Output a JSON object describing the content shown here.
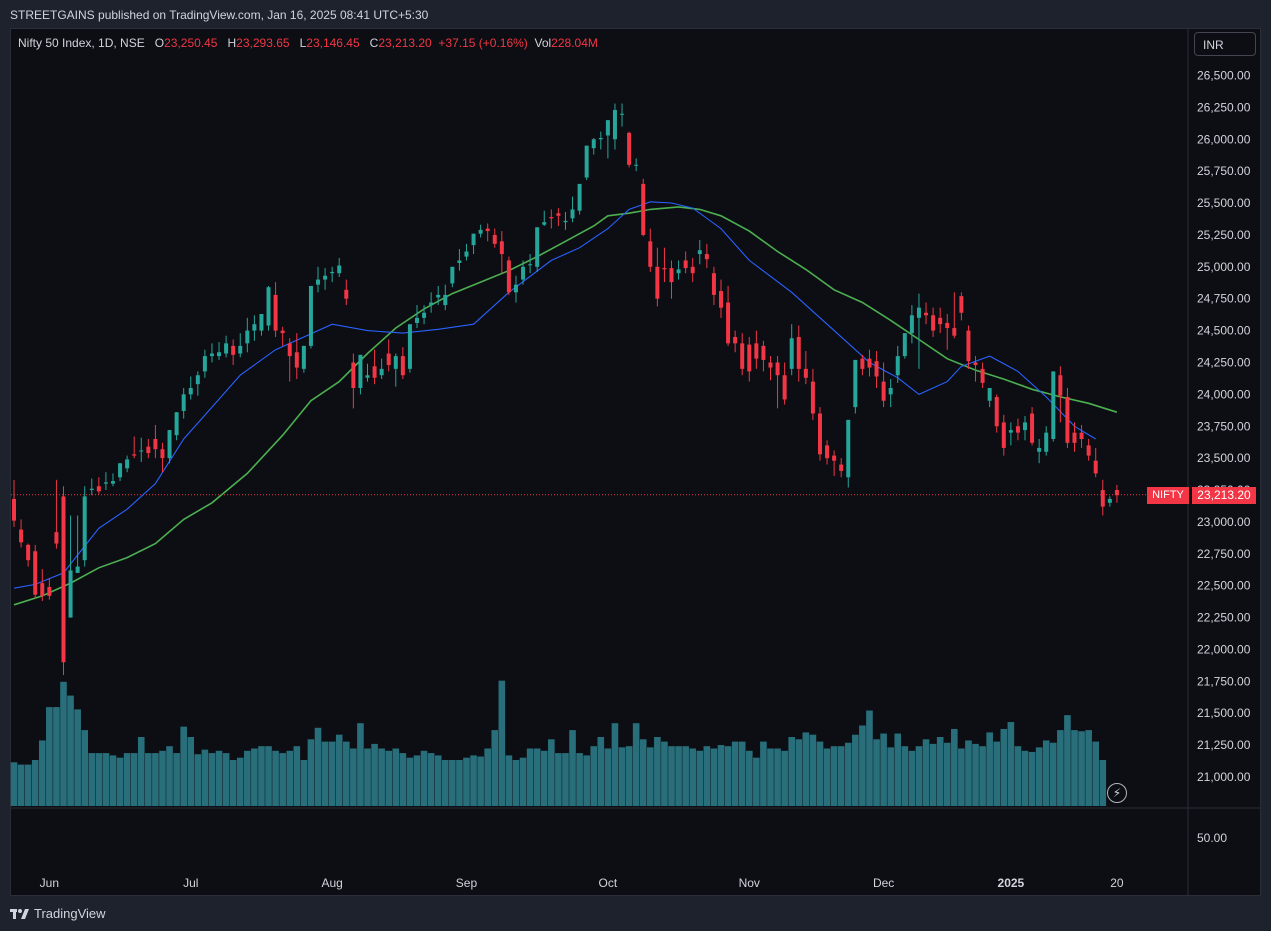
{
  "header": {
    "publish_line": "STREETGAINS published on TradingView.com, Jan 16, 2025 08:41 UTC+5:30"
  },
  "legend": {
    "symbol": "Nifty 50 Index, 1D, NSE",
    "open_label": "O",
    "open": "23,250.45",
    "high_label": "H",
    "high": "23,293.65",
    "low_label": "L",
    "low": "23,146.45",
    "close_label": "C",
    "close": "23,213.20",
    "change": "+37.15 (+0.16%)",
    "vol_label": "Vol",
    "vol": "228.04M"
  },
  "currency_button": "INR",
  "footer": {
    "brand": "TradingView",
    "logo_icon": "tradingview-logo-icon"
  },
  "bolt_icon": "lightning-icon",
  "colors": {
    "up": "#26a69a",
    "down": "#f23645",
    "ma_fast": "#2962ff",
    "ma_slow": "#4caf50",
    "volume": "#2a7581",
    "background": "#0c0e13"
  },
  "chart_data": {
    "type": "candlestick",
    "symbol_tag": "NIFTY",
    "last_price_label": "23,213.20",
    "last_price": 23213.2,
    "price_axis": {
      "ylim": [
        20850,
        26650
      ],
      "ticks": [
        "26,500.00",
        "26,250.00",
        "26,000.00",
        "25,750.00",
        "25,500.00",
        "25,250.00",
        "25,000.00",
        "24,750.00",
        "24,500.00",
        "24,250.00",
        "24,000.00",
        "23,750.00",
        "23,500.00",
        "23,250.00",
        "23,000.00",
        "22,750.00",
        "22,500.00",
        "22,250.00",
        "22,000.00",
        "21,750.00",
        "21,500.00",
        "21,250.00",
        "21,000.00"
      ],
      "tick_values": [
        26500,
        26250,
        26000,
        25750,
        25500,
        25250,
        25000,
        24750,
        24500,
        24250,
        24000,
        23750,
        23500,
        23250,
        23000,
        22750,
        22500,
        22250,
        22000,
        21750,
        21500,
        21250,
        21000
      ]
    },
    "lower_pane_tick": "50.00",
    "x_axis_labels": [
      "Jun",
      "Jul",
      "Aug",
      "Sep",
      "Oct",
      "Nov",
      "Dec",
      "2025",
      "20"
    ],
    "x_axis_label_index": [
      5,
      25,
      45,
      64,
      84,
      104,
      123,
      141,
      156
    ],
    "candles": [
      [
        23180,
        23330,
        23010,
        22960
      ],
      [
        22940,
        23020,
        22840,
        22800
      ],
      [
        22820,
        22830,
        22700,
        22650
      ],
      [
        22770,
        22820,
        22430,
        22400
      ],
      [
        22520,
        22630,
        22420,
        22380
      ],
      [
        22490,
        22560,
        22420,
        22390
      ],
      [
        22920,
        23330,
        22830,
        22790
      ],
      [
        23200,
        23280,
        21900,
        21800
      ],
      [
        22250,
        23050,
        22620,
        22570
      ],
      [
        22600,
        23050,
        22650,
        22600
      ],
      [
        22700,
        23280,
        23200,
        22650
      ],
      [
        23250,
        23340,
        23260,
        23210
      ],
      [
        23280,
        23350,
        23240,
        23220
      ],
      [
        23300,
        23390,
        23310,
        23250
      ],
      [
        23300,
        23380,
        23320,
        23280
      ],
      [
        23350,
        23440,
        23460,
        23320
      ],
      [
        23420,
        23520,
        23490,
        23390
      ],
      [
        23530,
        23670,
        23520,
        23500
      ],
      [
        23560,
        23660,
        23560,
        23470
      ],
      [
        23590,
        23650,
        23540,
        23500
      ],
      [
        23650,
        23760,
        23570,
        23500
      ],
      [
        23570,
        23620,
        23500,
        23390
      ],
      [
        23500,
        23550,
        23720,
        23460
      ],
      [
        23680,
        23820,
        23860,
        23640
      ],
      [
        23870,
        24050,
        24000,
        23810
      ],
      [
        24000,
        24140,
        24050,
        23960
      ],
      [
        24080,
        24180,
        24150,
        23990
      ],
      [
        24180,
        24350,
        24300,
        24130
      ],
      [
        24300,
        24400,
        24320,
        24250
      ],
      [
        24300,
        24410,
        24330,
        24270
      ],
      [
        24320,
        24460,
        24400,
        24290
      ],
      [
        24380,
        24430,
        24310,
        24230
      ],
      [
        24320,
        24480,
        24380,
        24290
      ],
      [
        24400,
        24600,
        24500,
        24330
      ],
      [
        24500,
        24620,
        24550,
        24420
      ],
      [
        24500,
        24620,
        24630,
        24460
      ],
      [
        24540,
        24850,
        24840,
        24500
      ],
      [
        24780,
        24880,
        24500,
        24450
      ],
      [
        24500,
        24530,
        24480,
        24380
      ],
      [
        24400,
        24440,
        24300,
        24100
      ],
      [
        24330,
        24480,
        24210,
        24120
      ],
      [
        24200,
        24350,
        24380,
        24170
      ],
      [
        24380,
        24840,
        24850,
        24360
      ],
      [
        24860,
        25000,
        24900,
        24800
      ],
      [
        24900,
        24990,
        24930,
        24820
      ],
      [
        24950,
        25000,
        24960,
        24880
      ],
      [
        24950,
        25070,
        25010,
        24920
      ],
      [
        24820,
        24900,
        24750,
        24700
      ],
      [
        24250,
        24320,
        24050,
        23890
      ],
      [
        24050,
        24310,
        24310,
        24000
      ],
      [
        24130,
        24240,
        24150,
        24100
      ],
      [
        24220,
        24350,
        24130,
        24080
      ],
      [
        24150,
        24280,
        24200,
        24120
      ],
      [
        24320,
        24430,
        24230,
        24180
      ],
      [
        24200,
        24320,
        24300,
        24060
      ],
      [
        24300,
        24370,
        24150,
        24120
      ],
      [
        24200,
        24550,
        24550,
        24170
      ],
      [
        24560,
        24700,
        24600,
        24520
      ],
      [
        24600,
        24700,
        24640,
        24550
      ],
      [
        24700,
        24800,
        24720,
        24640
      ],
      [
        24760,
        24850,
        24780,
        24700
      ],
      [
        24700,
        24860,
        24780,
        24660
      ],
      [
        24870,
        24990,
        25000,
        24840
      ],
      [
        25030,
        25140,
        25050,
        24970
      ],
      [
        25080,
        25180,
        25120,
        25050
      ],
      [
        25170,
        25260,
        25260,
        25100
      ],
      [
        25260,
        25330,
        25290,
        25230
      ],
      [
        25300,
        25340,
        25280,
        25200
      ],
      [
        25250,
        25300,
        25180,
        25150
      ],
      [
        25200,
        25280,
        25100,
        24950
      ],
      [
        25050,
        25080,
        24800,
        24780
      ],
      [
        24800,
        24930,
        24860,
        24720
      ],
      [
        24900,
        25050,
        25000,
        24860
      ],
      [
        25020,
        25100,
        25020,
        24950
      ],
      [
        25000,
        25200,
        25310,
        24960
      ],
      [
        25330,
        25440,
        25350,
        25320
      ],
      [
        25390,
        25450,
        25380,
        25300
      ],
      [
        25420,
        25460,
        25400,
        25320
      ],
      [
        25350,
        25430,
        25360,
        25290
      ],
      [
        25380,
        25550,
        25450,
        25350
      ],
      [
        25440,
        25650,
        25650,
        25410
      ],
      [
        25700,
        25850,
        25950,
        25680
      ],
      [
        25930,
        26010,
        26000,
        25880
      ],
      [
        26000,
        26060,
        26010,
        25920
      ],
      [
        26030,
        26110,
        26150,
        25850
      ],
      [
        26000,
        26280,
        26230,
        25920
      ],
      [
        26200,
        26280,
        26200,
        26100
      ],
      [
        26050,
        26060,
        25800,
        25780
      ],
      [
        25800,
        25850,
        25800,
        25750
      ],
      [
        25650,
        25690,
        25250,
        25240
      ],
      [
        25200,
        25300,
        25000,
        24960
      ],
      [
        25000,
        25150,
        24750,
        24690
      ],
      [
        24990,
        25150,
        24980,
        24880
      ],
      [
        24990,
        25050,
        24880,
        24750
      ],
      [
        24950,
        25050,
        24980,
        24900
      ],
      [
        25050,
        25120,
        24990,
        24950
      ],
      [
        25000,
        25070,
        24950,
        24880
      ],
      [
        25100,
        25210,
        25130,
        25020
      ],
      [
        25100,
        25180,
        25060,
        24990
      ],
      [
        24950,
        25000,
        24780,
        24700
      ],
      [
        24810,
        24900,
        24680,
        24600
      ],
      [
        24720,
        24850,
        24400,
        24380
      ],
      [
        24450,
        24500,
        24400,
        24330
      ],
      [
        24400,
        24480,
        24200,
        24150
      ],
      [
        24390,
        24450,
        24180,
        24100
      ],
      [
        24400,
        24500,
        24280,
        24200
      ],
      [
        24380,
        24420,
        24270,
        24180
      ],
      [
        24250,
        24300,
        24210,
        24110
      ],
      [
        24250,
        24300,
        24150,
        23890
      ],
      [
        24150,
        24250,
        23960,
        23920
      ],
      [
        24200,
        24550,
        24440,
        24150
      ],
      [
        24450,
        24540,
        24200,
        24100
      ],
      [
        24200,
        24340,
        24130,
        24080
      ],
      [
        24100,
        24200,
        23850,
        23800
      ],
      [
        23850,
        23900,
        23530,
        23480
      ],
      [
        23600,
        23640,
        23500,
        23450
      ],
      [
        23520,
        23560,
        23480,
        23360
      ],
      [
        23450,
        23500,
        23400,
        23350
      ],
      [
        23350,
        23580,
        23800,
        23270
      ],
      [
        23900,
        24270,
        24270,
        23850
      ],
      [
        24280,
        24310,
        24200,
        24150
      ],
      [
        24280,
        24350,
        24210,
        24140
      ],
      [
        24260,
        24340,
        24140,
        24050
      ],
      [
        24100,
        24250,
        23950,
        23900
      ],
      [
        24000,
        24120,
        24050,
        23900
      ],
      [
        24150,
        24380,
        24300,
        24090
      ],
      [
        24300,
        24420,
        24480,
        24280
      ],
      [
        24480,
        24700,
        24620,
        24400
      ],
      [
        24600,
        24790,
        24680,
        24200
      ],
      [
        24640,
        24720,
        24620,
        24550
      ],
      [
        24620,
        24680,
        24500,
        24450
      ],
      [
        24600,
        24680,
        24550,
        24480
      ],
      [
        24560,
        24630,
        24520,
        24350
      ],
      [
        24520,
        24800,
        24460,
        24440
      ],
      [
        24770,
        24800,
        24640,
        24580
      ],
      [
        24500,
        24540,
        24260,
        24200
      ],
      [
        24250,
        24300,
        24230,
        24100
      ],
      [
        24200,
        24250,
        24090,
        24050
      ],
      [
        23950,
        24050,
        24050,
        23900
      ],
      [
        23980,
        24000,
        23750,
        23700
      ],
      [
        23780,
        23840,
        23580,
        23520
      ],
      [
        23700,
        23780,
        23720,
        23600
      ],
      [
        23750,
        23810,
        23700,
        23640
      ],
      [
        23720,
        23830,
        23780,
        23640
      ],
      [
        23850,
        23900,
        23620,
        23600
      ],
      [
        23550,
        23650,
        23580,
        23460
      ],
      [
        23550,
        23750,
        23700,
        23520
      ],
      [
        23650,
        24150,
        24180,
        23630
      ],
      [
        24150,
        24220,
        23990,
        23780
      ],
      [
        23980,
        24050,
        23620,
        23580
      ],
      [
        23700,
        23780,
        23620,
        23550
      ],
      [
        23700,
        23760,
        23650,
        23580
      ],
      [
        23600,
        23650,
        23520,
        23480
      ],
      [
        23480,
        23580,
        23380,
        23350
      ],
      [
        23250,
        23330,
        23120,
        23050
      ],
      [
        23150,
        23200,
        23180,
        23120
      ],
      [
        23250,
        23290,
        23210,
        23150
      ]
    ],
    "volume": [
      38,
      36,
      36,
      40,
      57,
      86,
      86,
      108,
      96,
      84,
      66,
      46,
      46,
      46,
      44,
      42,
      46,
      46,
      60,
      46,
      46,
      48,
      52,
      46,
      69,
      60,
      45,
      49,
      46,
      48,
      46,
      40,
      42,
      48,
      50,
      52,
      52,
      48,
      46,
      48,
      52,
      40,
      58,
      68,
      56,
      56,
      62,
      56,
      50,
      72,
      50,
      54,
      50,
      48,
      50,
      46,
      42,
      44,
      48,
      46,
      44,
      40,
      40,
      40,
      42,
      44,
      43,
      50,
      66,
      109,
      44,
      40,
      42,
      50,
      50,
      48,
      58,
      46,
      46,
      66,
      46,
      44,
      52,
      60,
      50,
      72,
      51,
      52,
      72,
      58,
      51,
      60,
      56,
      52,
      52,
      52,
      50,
      48,
      52,
      50,
      53,
      52,
      56,
      56,
      48,
      42,
      56,
      50,
      50,
      48,
      60,
      58,
      64,
      62,
      56,
      50,
      52,
      52,
      55,
      62,
      70,
      83,
      58,
      63,
      51,
      63,
      52,
      48,
      52,
      58,
      54,
      60,
      55,
      67,
      50,
      57,
      54,
      52,
      64,
      56,
      67,
      73,
      52,
      48,
      47,
      51,
      57,
      55,
      66,
      79,
      66,
      65,
      66,
      56,
      40
    ],
    "ma_fast": [
      [
        0,
        22480
      ],
      [
        3,
        22510
      ],
      [
        7,
        22600
      ],
      [
        12,
        22950
      ],
      [
        16,
        23100
      ],
      [
        20,
        23300
      ],
      [
        24,
        23650
      ],
      [
        28,
        23900
      ],
      [
        32,
        24150
      ],
      [
        37,
        24350
      ],
      [
        45,
        24550
      ],
      [
        50,
        24500
      ],
      [
        55,
        24480
      ],
      [
        60,
        24510
      ],
      [
        65,
        24550
      ],
      [
        70,
        24800
      ],
      [
        76,
        25050
      ],
      [
        80,
        25150
      ],
      [
        84,
        25300
      ],
      [
        87,
        25450
      ],
      [
        90,
        25510
      ],
      [
        93,
        25500
      ],
      [
        96,
        25460
      ],
      [
        100,
        25300
      ],
      [
        104,
        25050
      ],
      [
        110,
        24800
      ],
      [
        115,
        24550
      ],
      [
        121,
        24250
      ],
      [
        125,
        24130
      ],
      [
        128,
        24000
      ],
      [
        132,
        24100
      ],
      [
        134,
        24220
      ],
      [
        138,
        24300
      ],
      [
        142,
        24180
      ],
      [
        146,
        23980
      ],
      [
        150,
        23750
      ],
      [
        153,
        23650
      ]
    ],
    "ma_slow": [
      [
        0,
        22350
      ],
      [
        4,
        22420
      ],
      [
        8,
        22520
      ],
      [
        12,
        22640
      ],
      [
        16,
        22720
      ],
      [
        20,
        22830
      ],
      [
        24,
        23020
      ],
      [
        28,
        23150
      ],
      [
        33,
        23380
      ],
      [
        38,
        23680
      ],
      [
        42,
        23950
      ],
      [
        46,
        24100
      ],
      [
        50,
        24320
      ],
      [
        54,
        24520
      ],
      [
        58,
        24670
      ],
      [
        62,
        24790
      ],
      [
        66,
        24880
      ],
      [
        70,
        24970
      ],
      [
        74,
        25080
      ],
      [
        78,
        25200
      ],
      [
        82,
        25320
      ],
      [
        84,
        25400
      ],
      [
        87,
        25420
      ],
      [
        90,
        25450
      ],
      [
        94,
        25470
      ],
      [
        97,
        25450
      ],
      [
        100,
        25400
      ],
      [
        104,
        25280
      ],
      [
        108,
        25120
      ],
      [
        112,
        24980
      ],
      [
        116,
        24820
      ],
      [
        120,
        24720
      ],
      [
        124,
        24580
      ],
      [
        128,
        24430
      ],
      [
        132,
        24280
      ],
      [
        136,
        24190
      ],
      [
        140,
        24120
      ],
      [
        144,
        24040
      ],
      [
        148,
        23980
      ],
      [
        152,
        23930
      ],
      [
        156,
        23860
      ]
    ]
  }
}
